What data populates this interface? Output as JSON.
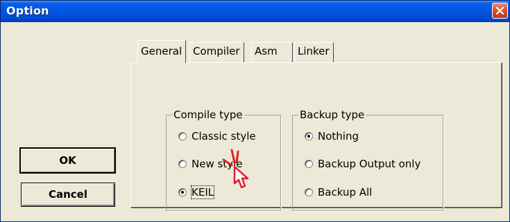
{
  "window": {
    "title": "Option"
  },
  "buttons": {
    "ok": "OK",
    "cancel": "Cancel"
  },
  "tabs": [
    {
      "label": "General",
      "selected": true
    },
    {
      "label": "Compiler",
      "selected": false
    },
    {
      "label": "Asm",
      "selected": false
    },
    {
      "label": "Linker",
      "selected": false
    }
  ],
  "compile_type": {
    "legend": "Compile type",
    "options": [
      {
        "label": "Classic style",
        "checked": false
      },
      {
        "label": "New style",
        "checked": false
      },
      {
        "label": "KEIL",
        "checked": true
      }
    ]
  },
  "backup_type": {
    "legend": "Backup type",
    "options": [
      {
        "label": "Nothing",
        "checked": true
      },
      {
        "label": "Backup Output only",
        "checked": false
      },
      {
        "label": "Backup All",
        "checked": false
      }
    ]
  },
  "colors": {
    "titlebar": "#0054e3",
    "close": "#d6492a",
    "face": "#ece9d8",
    "cursor_accent": "#e0202a"
  },
  "icons": {
    "close": "close-icon",
    "cursor": "hand-cursor-icon"
  }
}
